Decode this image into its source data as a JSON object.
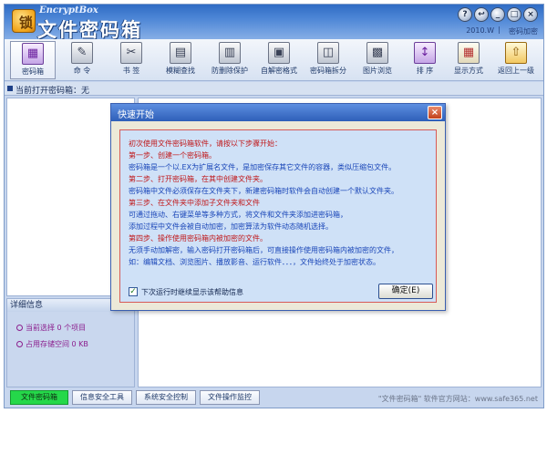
{
  "app": {
    "subtitle": "EncryptBox",
    "title": "文件密码箱",
    "logo_char": "锁",
    "version": "2010.W",
    "separator": "|",
    "register_label": "密码加密",
    "window_buttons": [
      "?",
      "↩",
      "_",
      "□",
      "×"
    ]
  },
  "toolbar": {
    "items": [
      {
        "label": "密码箱",
        "icon": "lock-box-icon",
        "glyph": "▦"
      },
      {
        "label": "命  令",
        "icon": "command-icon",
        "glyph": "✎"
      },
      {
        "label": "书  签",
        "icon": "bookmark-icon",
        "glyph": "✂"
      },
      {
        "label": "模糊查找",
        "icon": "fuzzy-search-icon",
        "glyph": "▤"
      },
      {
        "label": "防删除保护",
        "icon": "delete-protect-icon",
        "glyph": "▥"
      },
      {
        "label": "自解密格式",
        "icon": "self-decrypt-icon",
        "glyph": "▣"
      },
      {
        "label": "密码箱拆分",
        "icon": "split-icon",
        "glyph": "◫"
      },
      {
        "label": "图片浏览",
        "icon": "image-browse-icon",
        "glyph": "▩"
      },
      {
        "label": "排  序",
        "icon": "sort-icon",
        "glyph": "↕"
      },
      {
        "label": "显示方式",
        "icon": "display-mode-icon",
        "glyph": "▦"
      },
      {
        "label": "返回上一级",
        "icon": "up-level-icon",
        "glyph": "⇧"
      }
    ]
  },
  "current": {
    "label": "当前打开密码箱：无"
  },
  "detail": {
    "title": "详细信息",
    "selected": "当前选择 0 个项目",
    "space": "占用存储空间 0 KB"
  },
  "bottom_tabs": [
    {
      "label": "文件密码箱",
      "active": true
    },
    {
      "label": "信息安全工具",
      "active": false
    },
    {
      "label": "系统安全控制",
      "active": false
    },
    {
      "label": "文件操作监控",
      "active": false
    }
  ],
  "footer_note": "\"文件密码箱\" 软件官方网站：www.safe365.net",
  "dialog": {
    "title": "快速开始",
    "close_glyph": "×",
    "lines": [
      {
        "text": "初次使用文件密码箱软件，请按以下步骤开始：",
        "red": true
      },
      {
        "text": "第一步、创建一个密码箱。",
        "red": true
      },
      {
        "text": "密码箱是一个以.EX为扩展名文件，是加密保存其它文件的容器，类似压缩包文件。",
        "red": false
      },
      {
        "text": "第二步、打开密码箱，在其中创建文件夹。",
        "red": true
      },
      {
        "text": "密码箱中文件必须保存在文件夹下，新建密码箱时软件会自动创建一个默认文件夹。",
        "red": false
      },
      {
        "text": "第三步、在文件夹中添加子文件夹和文件",
        "red": true
      },
      {
        "text": "可通过拖动、右键菜单等多种方式，将文件和文件夹添加进密码箱，",
        "red": false
      },
      {
        "text": "添加过程中文件会被自动加密，加密算法为软件动态随机选择。",
        "red": false
      },
      {
        "text": "第四步、操作使用密码箱内被加密的文件。",
        "red": true
      },
      {
        "text": "无须手动加解密，输入密码打开密码箱后，可直接操作使用密码箱内被加密的文件，",
        "red": false
      },
      {
        "text": "如：编辑文档、浏览图片、播放影音、运行软件．．．，文件始终处于加密状态。",
        "red": false
      }
    ],
    "checkbox_label": "下次运行时继续显示该帮助信息",
    "checkbox_checked": "✓",
    "ok_label": "确定(E)"
  }
}
